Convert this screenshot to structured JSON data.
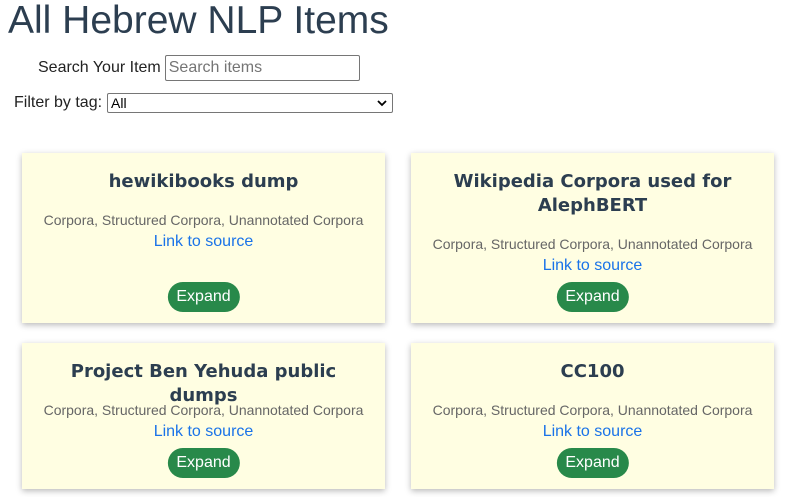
{
  "page": {
    "title": "All Hebrew NLP Items"
  },
  "search": {
    "label": "Search Your Item",
    "placeholder": "Search items",
    "value": ""
  },
  "filter": {
    "label": "Filter by tag:",
    "selected": "All"
  },
  "cards": [
    {
      "title": "hewikibooks dump",
      "tags": "Corpora, Structured Corpora, Unannotated Corpora",
      "link_label": "Link to source",
      "button_label": "Expand"
    },
    {
      "title": "Wikipedia Corpora used for AlephBERT",
      "tags": "Corpora, Structured Corpora, Unannotated Corpora",
      "link_label": "Link to source",
      "button_label": "Expand"
    },
    {
      "title": "Project Ben Yehuda public dumps",
      "tags": "Corpora, Structured Corpora, Unannotated Corpora",
      "link_label": "Link to source",
      "button_label": "Expand"
    },
    {
      "title": "CC100",
      "tags": "Corpora, Structured Corpora, Unannotated Corpora",
      "link_label": "Link to source",
      "button_label": "Expand"
    }
  ]
}
